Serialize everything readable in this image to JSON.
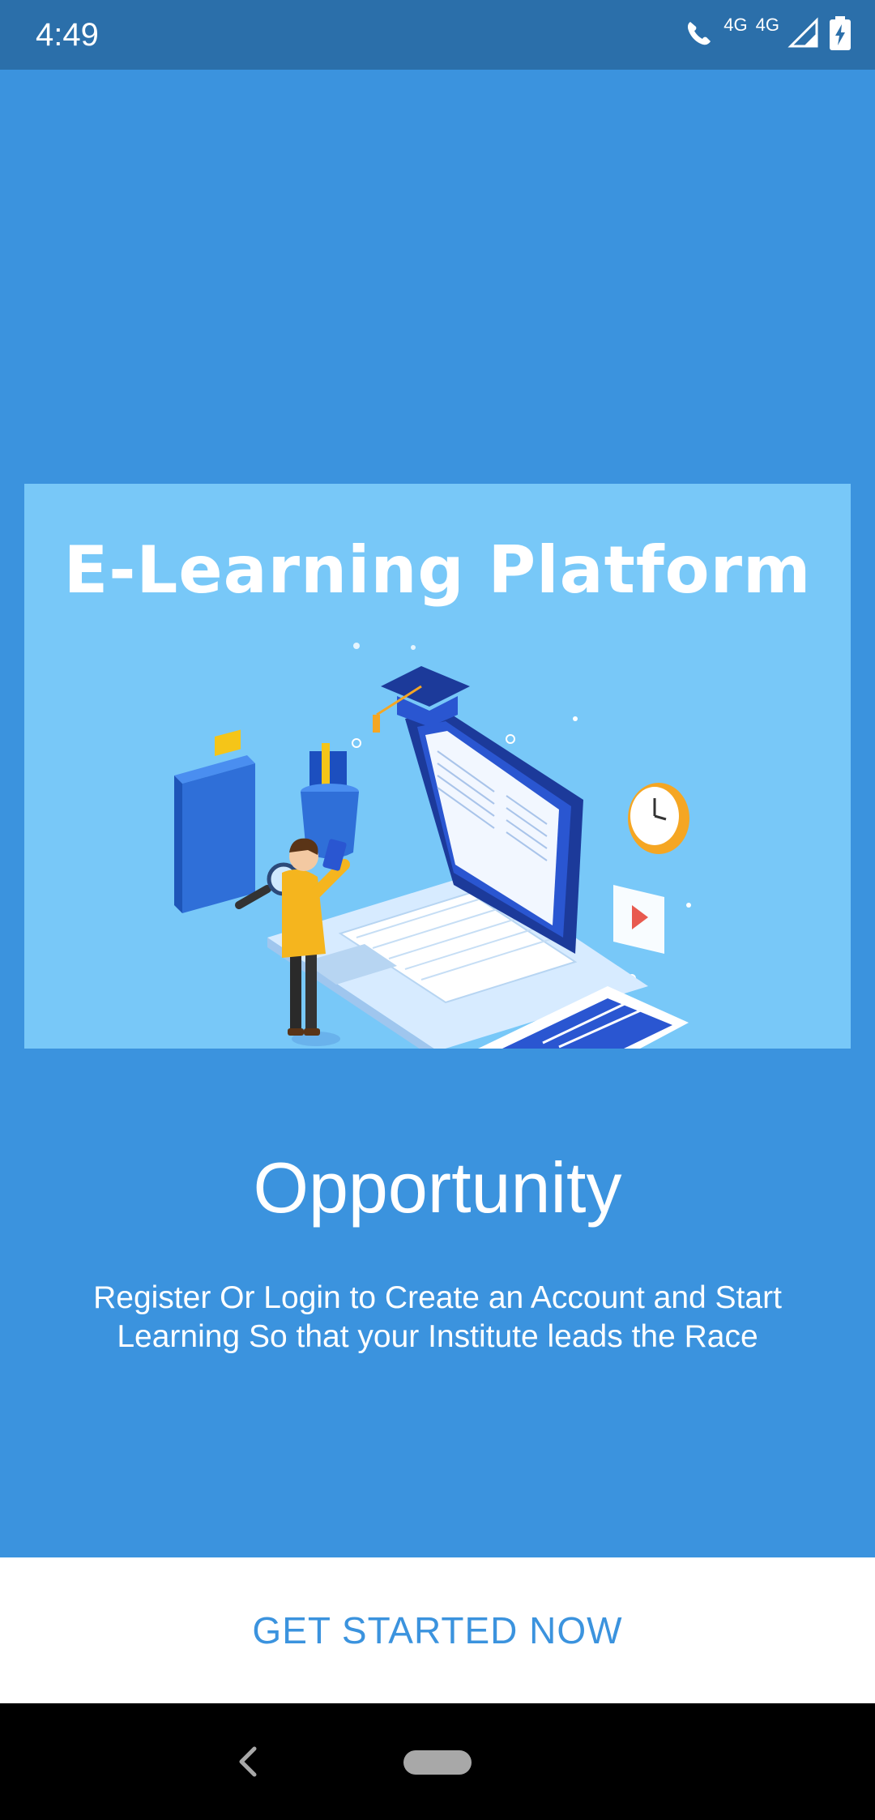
{
  "status_bar": {
    "time": "4:49",
    "network_label": "4G",
    "network_label_2": "4G",
    "icons": [
      "wifi-calling-icon",
      "signal-icon",
      "battery-charging-icon"
    ]
  },
  "hero": {
    "title": "E-Learning Platform",
    "illustration": "e-learning-illustration"
  },
  "onboarding": {
    "heading": "Opportunity",
    "description": "Register Or Login to Create an Account and Start Learning So that your Institute leads the Race"
  },
  "cta": {
    "label": "GET STARTED NOW"
  },
  "nav_bar": {
    "icons": [
      "back-icon",
      "home-pill-icon"
    ]
  },
  "colors": {
    "status_bar": "#2b6faa",
    "background": "#3b93de",
    "hero_background": "#78c8f8",
    "cta_text": "#3b93de",
    "nav_bar": "#000000"
  }
}
